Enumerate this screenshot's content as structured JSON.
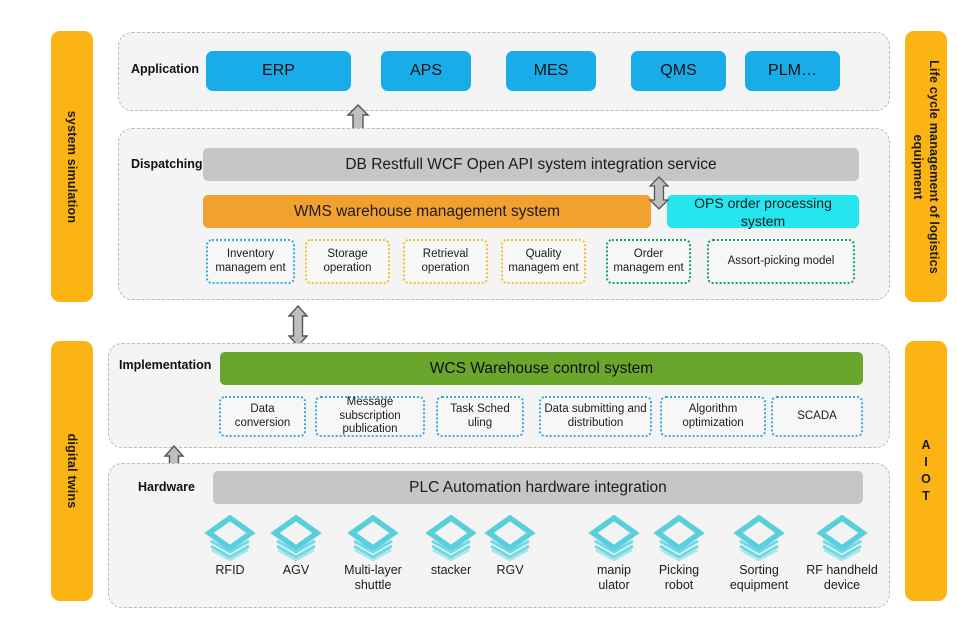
{
  "sidebars": {
    "left_top": {
      "label": "system simulation"
    },
    "left_bottom": {
      "label": "digital twins"
    },
    "right_top": {
      "label": "Life cycle management of logistics\nequipment"
    },
    "right_bottom": {
      "label": "A\nI\nO\nT"
    }
  },
  "colors": {
    "sidebar": "#FCB415",
    "application_button": "#18ADE8",
    "integration_bar": "#C6C6C6",
    "wms_bar": "#F2A030",
    "ops_bar": "#25E5EF",
    "wcs_bar": "#6AA52C",
    "plc_bar": "#C6C6C6",
    "hardware_icon": "#58D0DC",
    "panel_border": "#B9B9B9",
    "subbox_blue": "#36A9E1",
    "subbox_yellow": "#F2C230",
    "subbox_green": "#17A05E"
  },
  "layers": {
    "application": {
      "label": "Application",
      "buttons": [
        {
          "label": "ERP"
        },
        {
          "label": "APS"
        },
        {
          "label": "MES"
        },
        {
          "label": "QMS"
        },
        {
          "label": "PLM…"
        }
      ]
    },
    "dispatching": {
      "label": "Dispatching",
      "integration_bar": "DB Restfull WCF Open API system integration service",
      "wms_bar": "WMS warehouse  management  system",
      "ops_bar": "OPS order processing system",
      "modules": [
        {
          "label": "Inventory managem ent",
          "border": "blue"
        },
        {
          "label": "Storage operation",
          "border": "yellow"
        },
        {
          "label": "Retrieval operation",
          "border": "yellow"
        },
        {
          "label": "Quality managem ent",
          "border": "yellow"
        },
        {
          "label": "Order managem ent",
          "border": "green"
        },
        {
          "label": "Assort-picking model",
          "border": "green"
        }
      ]
    },
    "implementation": {
      "label": "Implementation",
      "wcs_bar": "WCS  Warehouse control  system",
      "modules": [
        {
          "label": "Data conversion",
          "border": "blue"
        },
        {
          "label": "Message subscription publication",
          "border": "blue"
        },
        {
          "label": "Task Sched uling",
          "border": "blue"
        },
        {
          "label": "Data submitting and distribution",
          "border": "blue"
        },
        {
          "label": "Algorithm optimization",
          "border": "blue"
        },
        {
          "label": "SCADA",
          "border": "blue"
        }
      ]
    },
    "hardware": {
      "label": "Hardware",
      "plc_bar": "PLC Automation hardware integration",
      "devices": [
        {
          "label": "RFID",
          "icon": "stacked-layers-icon"
        },
        {
          "label": "AGV",
          "icon": "stacked-layers-icon"
        },
        {
          "label": "Multi-layer\nshuttle",
          "icon": "stacked-layers-icon"
        },
        {
          "label": "stacker",
          "icon": "stacked-layers-icon"
        },
        {
          "label": "RGV",
          "icon": "stacked-layers-icon"
        },
        {
          "label": "manip\nulator",
          "icon": "stacked-layers-icon"
        },
        {
          "label": "Picking\nrobot",
          "icon": "stacked-layers-icon"
        },
        {
          "label": "Sorting\nequipment",
          "icon": "stacked-layers-icon"
        },
        {
          "label": "RF handheld\ndevice",
          "icon": "stacked-layers-icon"
        }
      ]
    }
  },
  "connectors": [
    {
      "name": "application-dispatching-arrow",
      "direction": "bidirectional"
    },
    {
      "name": "dispatching-implementation-arrow",
      "direction": "bidirectional"
    },
    {
      "name": "implementation-hardware-arrow",
      "direction": "bidirectional"
    },
    {
      "name": "wms-ops-arrow",
      "direction": "bidirectional"
    }
  ]
}
